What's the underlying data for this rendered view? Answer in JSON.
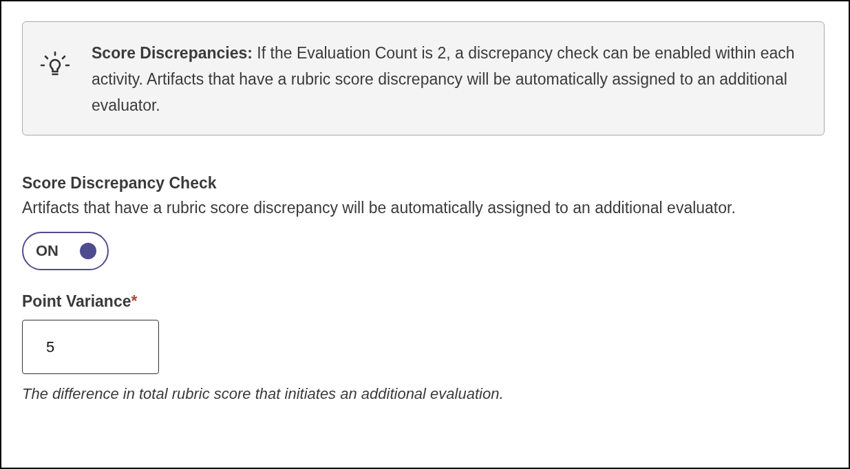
{
  "callout": {
    "text": "**Score Discrepancies:** If the Evaluation Count is 2, a discrepancy check can be enabled within each activity. Artifacts that have a rubric score discrepancy will be automatically assigned to an additional evaluator."
  },
  "discrepancy_check": {
    "title": "Score Discrepancy Check",
    "description": "Artifacts that have a rubric score discrepancy will be automatically assigned to an additional evaluator.",
    "toggle": {
      "label": "ON",
      "on": true
    }
  },
  "point_variance": {
    "label": "Point Variance",
    "required_mark": "*",
    "value": "5",
    "help": "The difference in total rubric score that initiates an additional evaluation."
  }
}
